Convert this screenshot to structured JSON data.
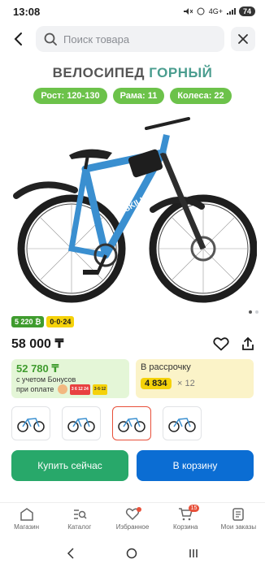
{
  "status_bar": {
    "time": "13:08",
    "network": "4G+",
    "battery": "74"
  },
  "search": {
    "placeholder": "Поиск товара"
  },
  "hero": {
    "title_part1": "ВЕЛОСИПЕД",
    "title_part2": "ГОРНЫЙ",
    "pills": [
      "Рост: 120-130",
      "Рама: 11",
      "Колеса: 22"
    ],
    "bike_brand": "SKILLMAX",
    "bike_color": "#3a8fd0"
  },
  "badges": {
    "green": "5 220 ₿",
    "yellow": "0·0·24"
  },
  "price": {
    "value": "58 000 ₸"
  },
  "bonus_offer": {
    "price": "52 780 ₸",
    "line1": "с учетом Бонусов",
    "line2": "при оплате",
    "pay1": "",
    "pay2": "3 6 12 24",
    "pay3": "3·6·12"
  },
  "installment": {
    "title": "В рассрочку",
    "amount": "4 834",
    "multiplier": "× 12"
  },
  "thumbnails_count": 4,
  "buttons": {
    "buy_now": "Купить сейчас",
    "add_to_cart": "В корзину"
  },
  "tabs": [
    {
      "label": "Магазин"
    },
    {
      "label": "Каталог"
    },
    {
      "label": "Избранное"
    },
    {
      "label": "Корзина",
      "badge": "15"
    },
    {
      "label": "Мои заказы"
    }
  ],
  "colors": {
    "accent_green": "#28a86a",
    "accent_blue": "#0b6dd3",
    "pill_green": "#6cc24a",
    "title_teal": "#4a9d8f"
  }
}
